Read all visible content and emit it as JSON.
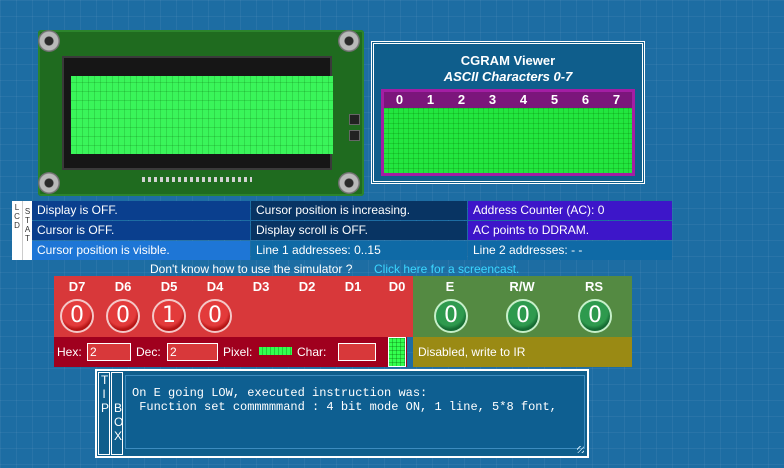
{
  "cgram": {
    "title": "CGRAM Viewer",
    "subtitle": "ASCII Characters 0-7",
    "indices": [
      "0",
      "1",
      "2",
      "3",
      "4",
      "5",
      "6",
      "7"
    ]
  },
  "status": {
    "label_col1": "LCD",
    "label_col2": "STAT",
    "display": "Display is OFF.",
    "cursor": "Cursor is OFF.",
    "cursor_visible": "Cursor position is visible.",
    "cursor_dir": "Cursor position is increasing.",
    "display_scroll": "Display scroll is OFF.",
    "line1_addresses": "Line 1 addresses: 0..15",
    "address_counter": "Address Counter (AC): 0",
    "ac_points": "AC points to DDRAM.",
    "line2_addresses": "Line 2 addresses: - -"
  },
  "help": {
    "prefix": "Don't know how to use the simulator ?",
    "link": "Click here for a screencast."
  },
  "data_pins": [
    {
      "label": "D7",
      "value": "0"
    },
    {
      "label": "D6",
      "value": "0"
    },
    {
      "label": "D5",
      "value": "1"
    },
    {
      "label": "D4",
      "value": "0"
    },
    {
      "label": "D3",
      "value": ""
    },
    {
      "label": "D2",
      "value": ""
    },
    {
      "label": "D1",
      "value": ""
    },
    {
      "label": "D0",
      "value": ""
    }
  ],
  "control_pins": [
    {
      "label": "E",
      "value": "0"
    },
    {
      "label": "R/W",
      "value": "0"
    },
    {
      "label": "RS",
      "value": "0"
    }
  ],
  "values": {
    "hex_label": "Hex:",
    "hex_value": "2",
    "dec_label": "Dec:",
    "dec_value": "2",
    "pixel_label": "Pixel:",
    "char_label": "Char:",
    "char_value": ""
  },
  "ir_status": "Disabled, write to IR",
  "tip": {
    "label_col1": "TIP",
    "label_col2": "BOX",
    "text": "On E going LOW, executed instruction was:\n Function set commmmmand : 4 bit mode ON, 1 line, 5*8 font,"
  },
  "colors": {
    "background": "#1d6da3",
    "lcd_green": "#3af55a",
    "data_panel": "#d8383a",
    "control_panel": "#548a42"
  }
}
